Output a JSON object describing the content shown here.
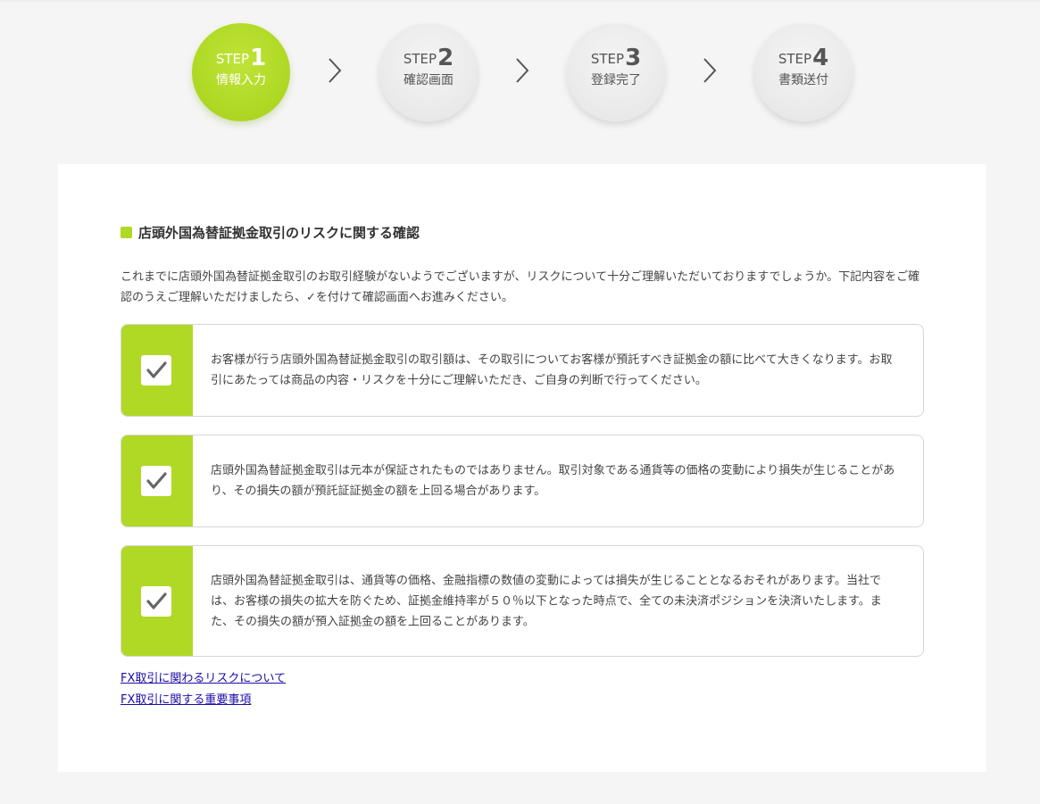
{
  "steps": [
    {
      "prefix": "STEP",
      "number": "1",
      "label": "情報入力",
      "active": true
    },
    {
      "prefix": "STEP",
      "number": "2",
      "label": "確認画面",
      "active": false
    },
    {
      "prefix": "STEP",
      "number": "3",
      "label": "登録完了",
      "active": false
    },
    {
      "prefix": "STEP",
      "number": "4",
      "label": "書類送付",
      "active": false
    }
  ],
  "section": {
    "title": "店頭外国為替証拠金取引のリスクに関する確認",
    "intro": "これまでに店頭外国為替証拠金取引のお取引経験がないようでございますが、リスクについて十分ご理解いただいておりますでしょうか。下記内容をご確認のうえご理解いただけましたら、✓を付けて確認画面へお進みください。"
  },
  "confirmations": [
    {
      "checked": true,
      "text": "お客様が行う店頭外国為替証拠金取引の取引額は、その取引についてお客様が預託すべき証拠金の額に比べて大きくなります。お取引にあたっては商品の内容・リスクを十分にご理解いただき、ご自身の判断で行ってください。"
    },
    {
      "checked": true,
      "text": "店頭外国為替証拠金取引は元本が保証されたものではありません。取引対象である通貨等の価格の変動により損失が生じることがあり、その損失の額が預託証証拠金の額を上回る場合があります。"
    },
    {
      "checked": true,
      "text": "店頭外国為替証拠金取引は、通貨等の価格、金融指標の数値の変動によっては損失が生じることとなるおそれがあります。当社では、お客様の損失の拡大を防ぐため、証拠金維持率が５０％以下となった時点で、全ての未決済ポジションを決済いたします。また、その損失の額が預入証拠金の額を上回ることがあります。"
    }
  ],
  "links": [
    {
      "label": "FX取引に関わるリスクについて"
    },
    {
      "label": "FX取引に関する重要事項"
    }
  ],
  "colors": {
    "accent": "#b0d925",
    "background": "#f5f5f5",
    "panel": "#ffffff",
    "link": "#1a0dab"
  },
  "icons": {
    "chevron": "chevron-right-icon",
    "check": "check-icon"
  }
}
